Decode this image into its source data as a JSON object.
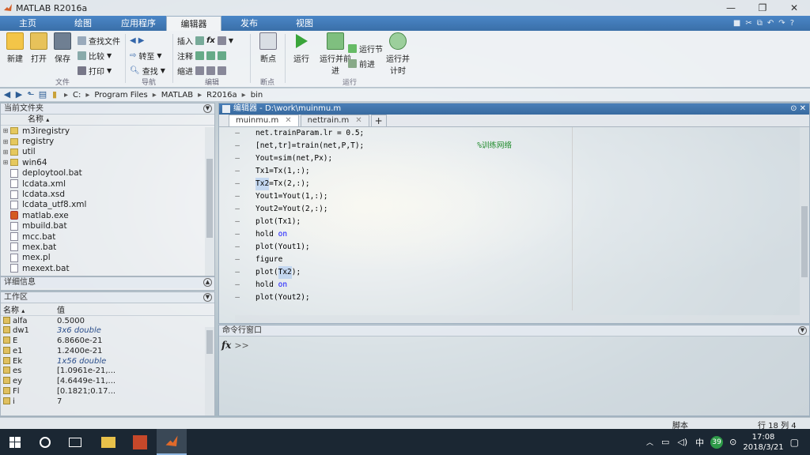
{
  "window": {
    "title": "MATLAB R2016a"
  },
  "ribbon_tabs": [
    "主页",
    "绘图",
    "应用程序",
    "编辑器",
    "发布",
    "视图"
  ],
  "ribbon_active_tab": "编辑器",
  "ribbon": {
    "file_group": {
      "label": "文件",
      "new": "新建",
      "open": "打开",
      "save": "保存",
      "find_files": "查找文件",
      "compare": "比较",
      "print": "打印"
    },
    "navigate_group": {
      "label": "导航",
      "goto": "转至",
      "find": "查找"
    },
    "edit_group": {
      "label": "编辑",
      "insert": "插入",
      "comment": "注释",
      "indent": "缩进",
      "fx": "fx"
    },
    "breakpoints_group": {
      "label": "断点",
      "breakpoints": "断点"
    },
    "run_group": {
      "label": "运行",
      "run": "运行",
      "run_advance": "运行并前进",
      "run_section": "运行节",
      "advance": "前进",
      "run_time": "运行并计时"
    }
  },
  "address": [
    "C:",
    "Program Files",
    "MATLAB",
    "R2016a",
    "bin"
  ],
  "current_folder": {
    "title": "当前文件夹",
    "column": "名称",
    "items": [
      {
        "name": "m3iregistry",
        "type": "folder"
      },
      {
        "name": "registry",
        "type": "folder"
      },
      {
        "name": "util",
        "type": "folder"
      },
      {
        "name": "win64",
        "type": "folder"
      },
      {
        "name": "deploytool.bat",
        "type": "file"
      },
      {
        "name": "lcdata.xml",
        "type": "file"
      },
      {
        "name": "lcdata.xsd",
        "type": "file"
      },
      {
        "name": "lcdata_utf8.xml",
        "type": "file"
      },
      {
        "name": "matlab.exe",
        "type": "exe"
      },
      {
        "name": "mbuild.bat",
        "type": "file"
      },
      {
        "name": "mcc.bat",
        "type": "file"
      },
      {
        "name": "mex.bat",
        "type": "file"
      },
      {
        "name": "mex.pl",
        "type": "file"
      },
      {
        "name": "mexext.bat",
        "type": "file"
      }
    ]
  },
  "details_title": "详细信息",
  "workspace": {
    "title": "工作区",
    "col_name": "名称",
    "col_value": "值",
    "rows": [
      {
        "name": "alfa",
        "value": "0.5000",
        "italic": false
      },
      {
        "name": "dw1",
        "value": "3x6 double",
        "italic": true
      },
      {
        "name": "E",
        "value": "6.8660e-21",
        "italic": false
      },
      {
        "name": "e1",
        "value": "1.2400e-21",
        "italic": false
      },
      {
        "name": "Ek",
        "value": "1x56 double",
        "italic": true
      },
      {
        "name": "es",
        "value": "[1.0961e-21,...",
        "italic": false
      },
      {
        "name": "ey",
        "value": "[4.6449e-11,...",
        "italic": false
      },
      {
        "name": "Fl",
        "value": "[0.1821;0.17...",
        "italic": false
      },
      {
        "name": "i",
        "value": "7",
        "italic": false
      }
    ]
  },
  "editor": {
    "title": "编辑器 - D:\\work\\muinmu.m",
    "tabs": [
      {
        "label": "muinmu.m",
        "active": true
      },
      {
        "label": "nettrain.m",
        "active": false
      }
    ],
    "add_tab": "+",
    "lines": [
      [
        {
          "t": "net.trainParam.lr = 0.5;"
        }
      ],
      [
        {
          "t": "[net,tr]=train(net,P,T);"
        },
        {
          "t": "                         %训练网络",
          "c": "cmt"
        }
      ],
      [
        {
          "t": "Yout=sim(net,Px);"
        }
      ],
      [
        {
          "t": "Tx1=Tx(1,:);"
        }
      ],
      [
        {
          "t": "Tx2",
          "c": "hl"
        },
        {
          "t": "=Tx(2,:);"
        }
      ],
      [
        {
          "t": "Yout1=Yout(1,:);"
        }
      ],
      [
        {
          "t": "Yout2=Yout(2,:);"
        }
      ],
      [
        {
          "t": "plot(Tx1);"
        }
      ],
      [
        {
          "t": "hold "
        },
        {
          "t": "on",
          "c": "kw"
        }
      ],
      [
        {
          "t": "plot(Yout1);"
        }
      ],
      [
        {
          "t": "figure"
        }
      ],
      [
        {
          "t": "plot("
        },
        {
          "t": "Tx2",
          "c": "hl"
        },
        {
          "t": ");"
        }
      ],
      [
        {
          "t": "hold "
        },
        {
          "t": "on",
          "c": "kw"
        }
      ],
      [
        {
          "t": "plot(Yout2);"
        }
      ]
    ]
  },
  "command_window": {
    "title": "命令行窗口",
    "prompt_icon": "fx",
    "prompt": ">>"
  },
  "status": {
    "mode": "脚本",
    "position": "行 18  列 4"
  },
  "taskbar": {
    "time": "17:08",
    "date": "2018/3/21",
    "ime": "中",
    "badge": "39"
  }
}
